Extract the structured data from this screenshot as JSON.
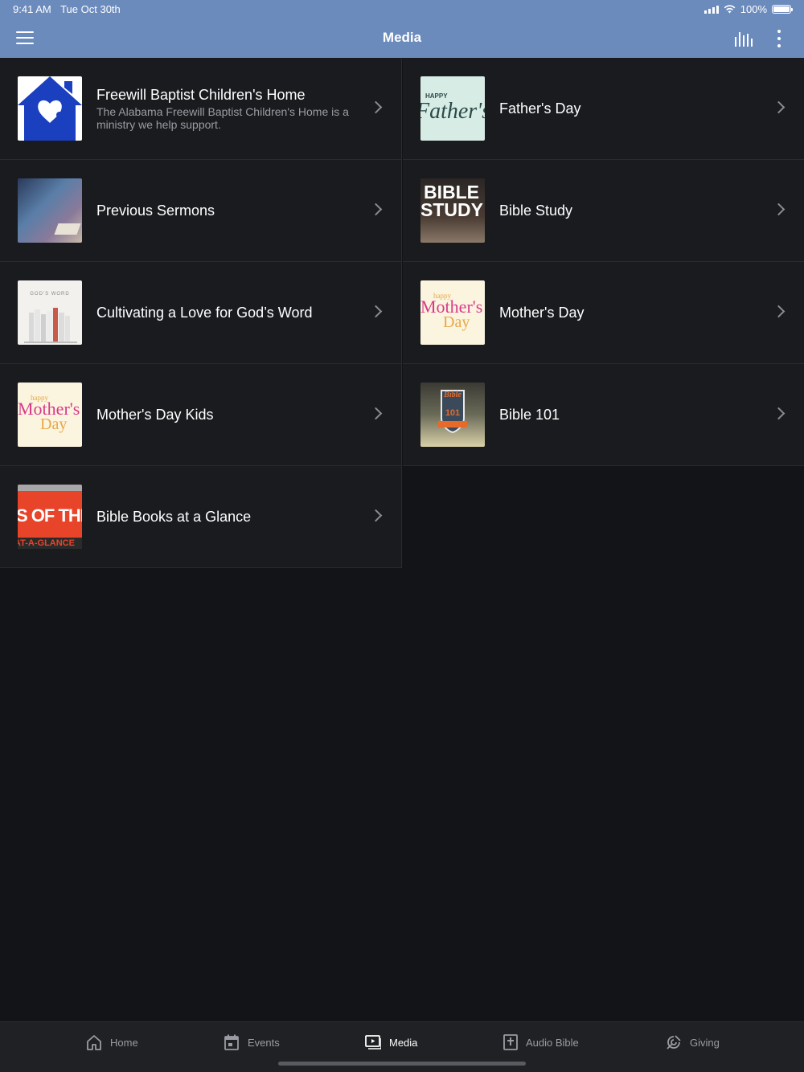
{
  "status_bar": {
    "time": "9:41 AM",
    "date": "Tue Oct 30th",
    "battery": "100%"
  },
  "header": {
    "title": "Media"
  },
  "items": [
    {
      "title": "Freewill Baptist Children's Home",
      "subtitle": "The Alabama Freewill Baptist Children's Home is a ministry we help support.",
      "thumbnail": "house-with-children-icon"
    },
    {
      "title": "Father's Day",
      "thumbnail_text": "Father's",
      "thumbnail_small": "HAPPY"
    },
    {
      "title": "Previous Sermons"
    },
    {
      "title": "Bible Study",
      "thumbnail_text_1": "BIBLE",
      "thumbnail_text_2": "STUDY"
    },
    {
      "title": "Cultivating a Love for God’s Word",
      "thumbnail_text": "GOD'S WORD"
    },
    {
      "title": "Mother's Day",
      "thumbnail_small": "happy",
      "thumbnail_text_1": "Mother's",
      "thumbnail_text_2": "Day"
    },
    {
      "title": "Mother's Day Kids",
      "thumbnail_small": "happy",
      "thumbnail_text_1": "Mother's",
      "thumbnail_text_2": "Day"
    },
    {
      "title": "Bible 101",
      "thumbnail_text_1": "Bible",
      "thumbnail_text_2": "101"
    },
    {
      "title": "Bible Books at a Glance",
      "thumbnail_text_1": "S OF THE",
      "thumbnail_text_2": "AT-A-GLANCE"
    }
  ],
  "tabs": [
    {
      "label": "Home",
      "icon": "home-icon"
    },
    {
      "label": "Events",
      "icon": "calendar-icon"
    },
    {
      "label": "Media",
      "icon": "media-icon",
      "active": true
    },
    {
      "label": "Audio Bible",
      "icon": "audio-bible-icon"
    },
    {
      "label": "Giving",
      "icon": "giving-icon"
    }
  ],
  "colors": {
    "header": "#6c8bbd",
    "background": "#131417",
    "row": "#1a1b1f",
    "tabbar": "#202124"
  }
}
